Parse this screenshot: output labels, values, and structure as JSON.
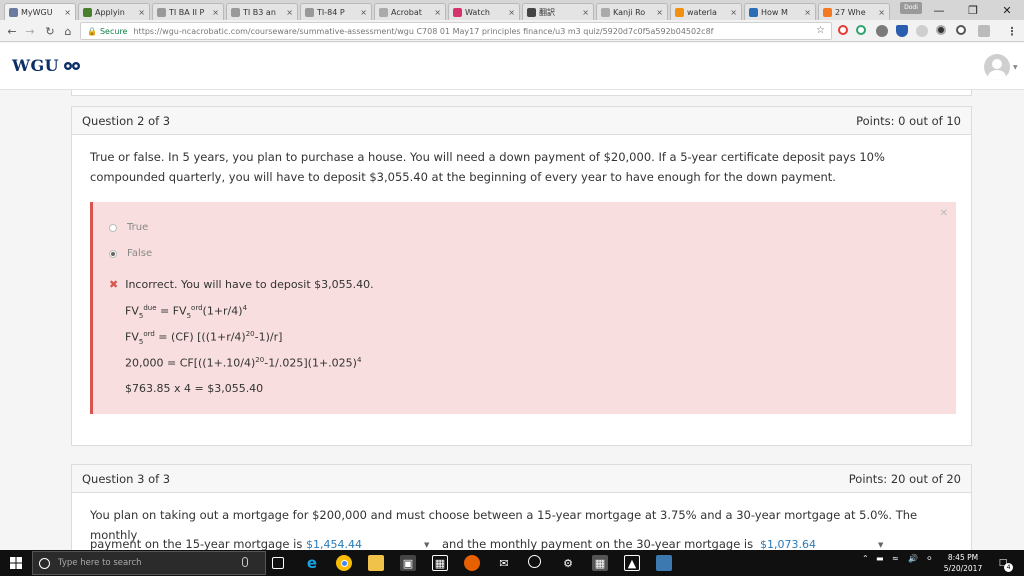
{
  "browser": {
    "tabs": [
      {
        "label": "MyWGU",
        "fav": "wgu-icon",
        "color": "#6b7aa1"
      },
      {
        "label": "Applyin",
        "fav": "globe-icon",
        "color": "#4a7f2d"
      },
      {
        "label": "TI BA II P",
        "fav": "ti-icon",
        "color": "#999999"
      },
      {
        "label": "TI B3 an",
        "fav": "ti-icon",
        "color": "#999999"
      },
      {
        "label": "TI-84 P",
        "fav": "ti-icon",
        "color": "#999999"
      },
      {
        "label": "Acrobat",
        "fav": "doc-icon",
        "color": "#aaaaaa"
      },
      {
        "label": "Watch",
        "fav": "heart-icon",
        "color": "#d6336c"
      },
      {
        "label": "翻訳",
        "fav": "square-icon",
        "color": "#444444"
      },
      {
        "label": "Kanji Ro",
        "fav": "doc-icon",
        "color": "#aaaaaa"
      },
      {
        "label": "waterla",
        "fav": "info-icon",
        "color": "#f29111"
      },
      {
        "label": "How M",
        "fav": "grid-icon",
        "color": "#2d6db5"
      },
      {
        "label": "27 Whe",
        "fav": "c-icon",
        "color": "#f47920"
      }
    ],
    "url_secure_label": "Secure",
    "url": "https://wgu-ncacrobatic.com/courseware/summative-assessment/wgu C708 01 May17 principles finance/u3 m3 quiz/5920d7c0f5a592b04502c8f"
  },
  "site": {
    "logo_text": "WGU"
  },
  "question2": {
    "header": "Question 2 of 3",
    "points": "Points: 0 out of 10",
    "text": "True or false. In 5 years, you plan to purchase a house. You will need a down payment of $20,000. If a 5-year certificate deposit pays 10% compounded quarterly, you will have to deposit $3,055.40 at the beginning of every year to have enough for the down payment.",
    "options": [
      "True",
      "False"
    ],
    "selected_index": 1,
    "feedback": "Incorrect. You will have to deposit $3,055.40.",
    "formulas": {
      "f1_a": "FV",
      "f1_b": "5",
      "f1_c": "due",
      "f1_d": " = FV",
      "f1_e": "5",
      "f1_f": "ord",
      "f1_g": "(1+r/4)",
      "f1_h": "4",
      "f2_a": "FV",
      "f2_b": "5",
      "f2_c": "ord",
      "f2_d": " = (CF) [((1+r/4)",
      "f2_e": "20",
      "f2_f": "-1)/r]",
      "f3_a": "20,000 = CF[((1+.10/4)",
      "f3_b": "20",
      "f3_c": "-1/.025](1+.025)",
      "f3_d": "4",
      "f4": "$763.85 x 4 = $3,055.40"
    }
  },
  "question3": {
    "header": "Question 3 of 3",
    "points": "Points: 20 out of 20",
    "text": "You plan on taking out a mortgage for $200,000 and must choose between a 15-year mortgage at 3.75% and a 30-year mortgage at 5.0%. The monthly",
    "line2_a": "payment on the 15-year mortgage is",
    "dropdown1": "$1,454.44",
    "line2_b": "and the monthly payment on the 30-year mortgage is",
    "dropdown2": "$1,073.64"
  },
  "taskbar": {
    "search_placeholder": "Type here to search",
    "time": "8:45 PM",
    "date": "5/20/2017",
    "notifications": "4"
  }
}
